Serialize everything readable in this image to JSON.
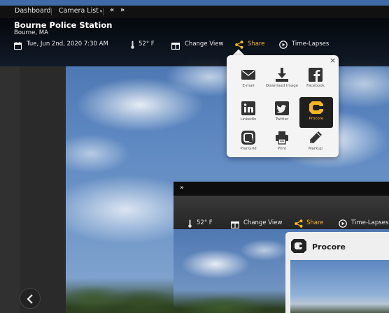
{
  "nav": {
    "dashboard": "Dashboard",
    "camera_list": "Camera List",
    "prev": "«",
    "next": "»"
  },
  "camera": {
    "title": "Bourne Police Station",
    "location": "Bourne, MA",
    "datetime": "Tue, Jun 2nd, 2020 7:30 AM"
  },
  "toolbar": {
    "temperature": "52° F",
    "change_view": "Change View",
    "share": "Share",
    "time_lapses": "Time-Lapses"
  },
  "share_menu": {
    "close": "×",
    "items": [
      {
        "label": "E-mail",
        "icon": "envelope-icon"
      },
      {
        "label": "Download Image",
        "icon": "download-icon"
      },
      {
        "label": "Facebook",
        "icon": "facebook-icon"
      },
      {
        "label": "LinkedIn",
        "icon": "linkedin-icon"
      },
      {
        "label": "Twitter",
        "icon": "twitter-icon"
      },
      {
        "label": "Procore",
        "icon": "procore-icon",
        "active": true
      },
      {
        "label": "PlanGrid",
        "icon": "plangrid-icon"
      },
      {
        "label": "Print",
        "icon": "printer-icon"
      },
      {
        "label": "Markup",
        "icon": "pencil-icon"
      }
    ]
  },
  "window2": {
    "nav_next": "»",
    "temperature": "52° F",
    "change_view": "Change View",
    "share": "Share",
    "time_lapses": "Time-Lapses",
    "procore_title": "Procore"
  },
  "colors": {
    "accent": "#f5b622",
    "topbar": "#111111",
    "popup_bg": "#f4f4f4"
  }
}
